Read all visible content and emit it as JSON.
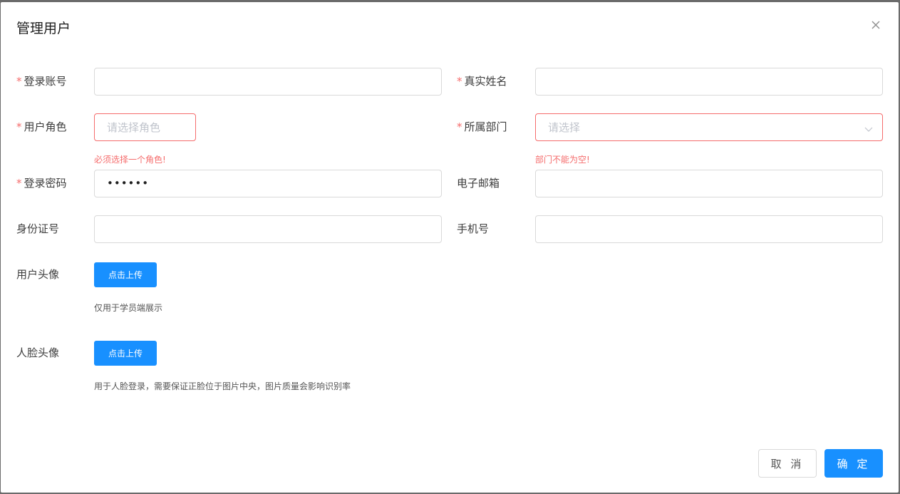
{
  "dialog": {
    "title": "管理用户",
    "close_icon": "close-icon"
  },
  "form": {
    "required_mark": "*",
    "login_account": {
      "label": "登录账号",
      "value": ""
    },
    "real_name": {
      "label": "真实姓名",
      "value": ""
    },
    "user_role": {
      "label": "用户角色",
      "placeholder": "请选择角色",
      "error": "必须选择一个角色!"
    },
    "department": {
      "label": "所属部门",
      "placeholder": "请选择",
      "error": "部门不能为空!",
      "chevron_icon": "chevron-down-icon"
    },
    "password": {
      "label": "登录密码",
      "masked_value": "••••••"
    },
    "email": {
      "label": "电子邮箱",
      "value": ""
    },
    "id_number": {
      "label": "身份证号",
      "value": ""
    },
    "phone": {
      "label": "手机号",
      "value": ""
    },
    "avatar": {
      "label": "用户头像",
      "button": "点击上传",
      "hint": "仅用于学员端展示"
    },
    "face": {
      "label": "人脸头像",
      "button": "点击上传",
      "hint": "用于人脸登录，需要保证正脸位于图片中央，图片质量会影响识别率"
    }
  },
  "footer": {
    "cancel": "取 消",
    "confirm": "确 定"
  },
  "colors": {
    "primary": "#1890ff",
    "error": "#f56c6c",
    "border": "#d9d9d9",
    "placeholder": "#c0c4cc"
  }
}
